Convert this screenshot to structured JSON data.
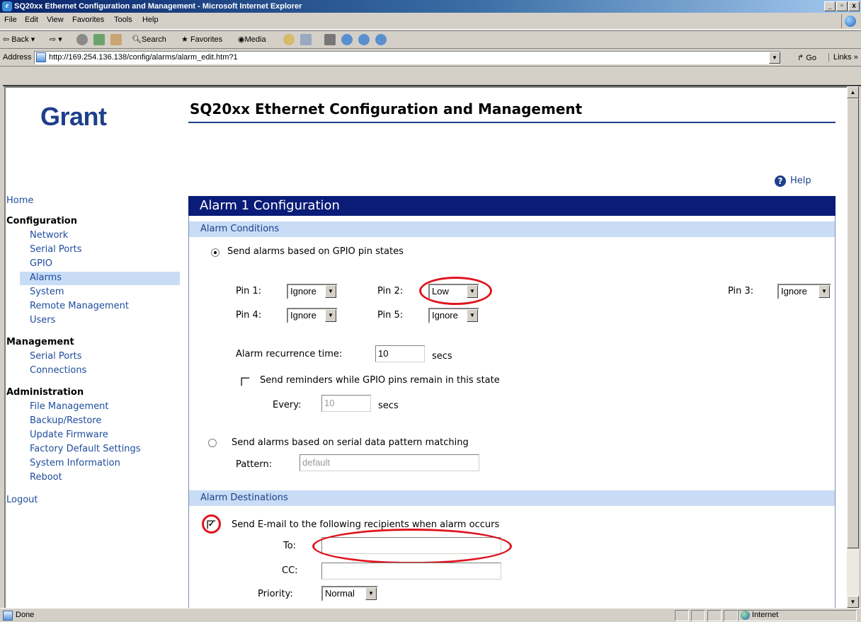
{
  "window": {
    "title": "SQ20xx Ethernet Configuration and Management - Microsoft Internet Explorer",
    "controls": {
      "minimize": "_",
      "maximize": "▫",
      "close": "x"
    }
  },
  "menubar": [
    "File",
    "Edit",
    "View",
    "Favorites",
    "Tools",
    "Help"
  ],
  "toolbar": {
    "back": "Back",
    "search": "Search",
    "favorites": "Favorites",
    "media": "Media"
  },
  "addressbar": {
    "label": "Address",
    "url": "http://169.254.136.138/config/alarms/alarm_edit.htm?1",
    "go": "Go",
    "links": "Links"
  },
  "page": {
    "logo": "Grant",
    "title": "SQ20xx Ethernet Configuration and Management",
    "help": "Help"
  },
  "nav": {
    "home": "Home",
    "configuration": {
      "heading": "Configuration",
      "items": [
        "Network",
        "Serial Ports",
        "GPIO",
        "Alarms",
        "System",
        "Remote Management",
        "Users"
      ],
      "active": "Alarms"
    },
    "management": {
      "heading": "Management",
      "items": [
        "Serial Ports",
        "Connections"
      ]
    },
    "administration": {
      "heading": "Administration",
      "items": [
        "File Management",
        "Backup/Restore",
        "Update Firmware",
        "Factory Default Settings",
        "System Information",
        "Reboot"
      ]
    },
    "logout": "Logout"
  },
  "form": {
    "section_title": "Alarm 1 Configuration",
    "conditions": {
      "heading": "Alarm Conditions",
      "gpio_option": "Send alarms based on GPIO pin states",
      "gpio_selected": true,
      "pins": [
        {
          "label": "Pin 1:",
          "value": "Ignore"
        },
        {
          "label": "Pin 2:",
          "value": "Low"
        },
        {
          "label": "Pin 3:",
          "value": "Ignore"
        },
        {
          "label": "Pin 4:",
          "value": "Ignore"
        },
        {
          "label": "Pin 5:",
          "value": "Ignore"
        }
      ],
      "recurrence_label": "Alarm recurrence time:",
      "recurrence_value": "10",
      "recurrence_unit": "secs",
      "reminder_label": "Send reminders while GPIO pins remain in this state",
      "reminder_checked": false,
      "every_label": "Every:",
      "every_value": "10",
      "every_unit": "secs",
      "serial_option": "Send alarms based on serial data pattern matching",
      "serial_selected": false,
      "pattern_label": "Pattern:",
      "pattern_placeholder": "default"
    },
    "destinations": {
      "heading": "Alarm Destinations",
      "email_label": "Send E-mail to the following recipients when alarm occurs",
      "email_checked": true,
      "to_label": "To:",
      "to_value": "",
      "cc_label": "CC:",
      "cc_value": "",
      "priority_label": "Priority:",
      "priority_value": "Normal"
    }
  },
  "statusbar": {
    "text": "Done",
    "zone": "Internet"
  },
  "colors": {
    "accent": "#0a1c78",
    "subhead_bg": "#c8dcf5",
    "highlight_ring": "#e0141e",
    "link": "#1e4c9c"
  }
}
